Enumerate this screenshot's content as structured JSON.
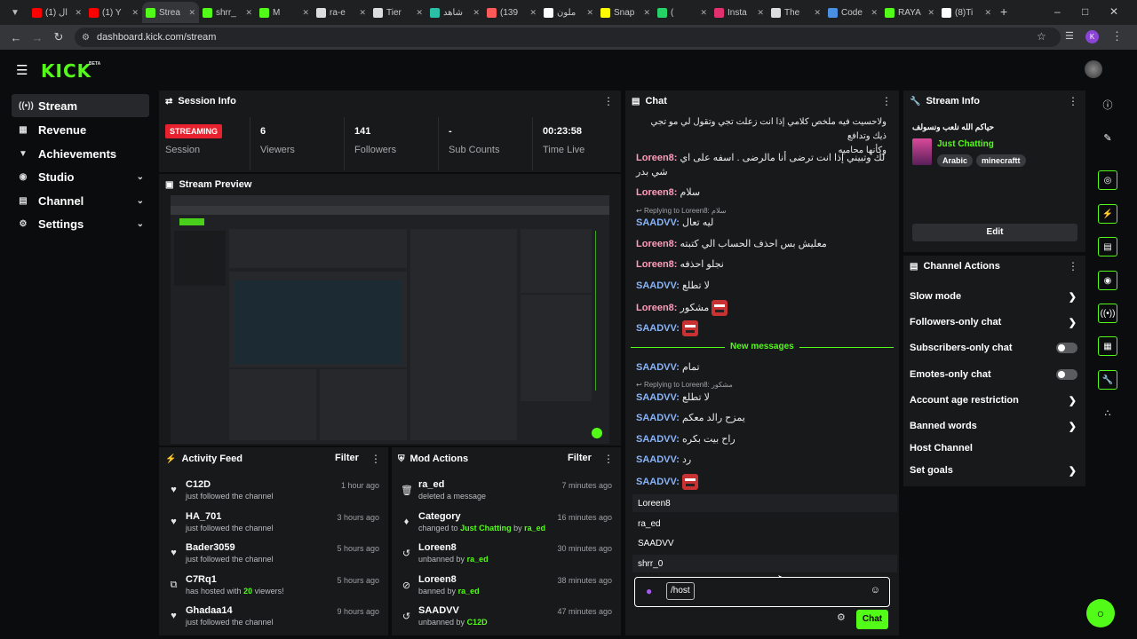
{
  "browser": {
    "tabs": [
      {
        "label": "(1) ال",
        "color": "#ff0000",
        "icon": "youtube-icon"
      },
      {
        "label": "(1) Y",
        "color": "#ff0000",
        "icon": "youtube-icon"
      },
      {
        "label": "Strea",
        "color": "#53fc18",
        "icon": "kick-icon",
        "active": true
      },
      {
        "label": "shrr_",
        "color": "#53fc18",
        "icon": "kick-icon"
      },
      {
        "label": "M",
        "color": "#53fc18",
        "icon": "kick-icon"
      },
      {
        "label": "ra-e",
        "color": "#dddddd",
        "icon": "site-icon"
      },
      {
        "label": "Tier",
        "color": "#dddddd",
        "icon": "site-icon"
      },
      {
        "label": "شاهد",
        "color": "#29c0a6",
        "icon": "site-icon"
      },
      {
        "label": "(139",
        "color": "#ff5a5a",
        "icon": "site-icon"
      },
      {
        "label": "ملون",
        "color": "#ffffff",
        "icon": "google-icon"
      },
      {
        "label": "Snap",
        "color": "#fffc00",
        "icon": "snapchat-icon"
      },
      {
        "label": "(",
        "color": "#25d366",
        "icon": "whatsapp-icon"
      },
      {
        "label": "Insta",
        "color": "#e1306c",
        "icon": "instagram-icon"
      },
      {
        "label": "The",
        "color": "#dddddd",
        "icon": "site-icon"
      },
      {
        "label": "Code",
        "color": "#4a90e2",
        "icon": "site-icon"
      },
      {
        "label": "RAYA",
        "color": "#53fc18",
        "icon": "kick-icon"
      },
      {
        "label": "(8)Ti",
        "color": "#ffffff",
        "icon": "tiktok-icon"
      }
    ],
    "url": "dashboard.kick.com/stream"
  },
  "brand": {
    "logo": "KICK",
    "beta": "BETA",
    "accent": "#53fc18"
  },
  "sidebar": {
    "items": [
      {
        "label": "Stream",
        "icon": "broadcast-icon",
        "active": true
      },
      {
        "label": "Revenue",
        "icon": "money-icon"
      },
      {
        "label": "Achievements",
        "icon": "trophy-icon"
      },
      {
        "label": "Studio",
        "icon": "studio-icon",
        "expandable": true
      },
      {
        "label": "Channel",
        "icon": "channel-icon",
        "expandable": true
      },
      {
        "label": "Settings",
        "icon": "gear-icon",
        "expandable": true
      }
    ]
  },
  "session": {
    "title": "Session Info",
    "status": "STREAMING",
    "status_label": "Session",
    "stats": [
      {
        "value": "6",
        "label": "Viewers"
      },
      {
        "value": "141",
        "label": "Followers"
      },
      {
        "value": "-",
        "label": "Sub Counts"
      },
      {
        "value": "00:23:58",
        "label": "Time Live"
      }
    ]
  },
  "preview": {
    "title": "Stream Preview"
  },
  "activity": {
    "title": "Activity Feed",
    "filter": "Filter",
    "items": [
      {
        "icon": "heart-icon",
        "name": "C12D",
        "desc": "just followed the channel",
        "time": "1 hour ago"
      },
      {
        "icon": "heart-icon",
        "name": "HA_701",
        "desc": "just followed the channel",
        "time": "3 hours ago"
      },
      {
        "icon": "heart-icon",
        "name": "Bader3059",
        "desc": "just followed the channel",
        "time": "5 hours ago"
      },
      {
        "icon": "host-icon",
        "name": "C7Rq1",
        "desc_pre": "has hosted with",
        "count": "20",
        "desc_post": "viewers!",
        "time": "5 hours ago"
      },
      {
        "icon": "heart-icon",
        "name": "Ghadaa14",
        "desc": "just followed the channel",
        "time": "9 hours ago"
      }
    ]
  },
  "modactions": {
    "title": "Mod Actions",
    "filter": "Filter",
    "items": [
      {
        "icon": "trash-icon",
        "name": "ra_ed",
        "desc": "deleted a message",
        "time": "7 minutes ago"
      },
      {
        "icon": "category-icon",
        "name": "Category",
        "desc_pre": "changed to",
        "target": "Just Chatting",
        "by": "by",
        "actor": "ra_ed",
        "time": "16 minutes ago"
      },
      {
        "icon": "unban-icon",
        "name": "Loreen8",
        "desc_pre": "unbanned by",
        "actor": "ra_ed",
        "time": "30 minutes ago"
      },
      {
        "icon": "ban-icon",
        "name": "Loreen8",
        "desc_pre": "banned by",
        "actor": "ra_ed",
        "time": "38 minutes ago"
      },
      {
        "icon": "unban-icon",
        "name": "SAADVV",
        "desc_pre": "unbanned by",
        "actor": "C12D",
        "time": "47 minutes ago"
      }
    ]
  },
  "chat": {
    "title": "Chat",
    "top_text_1": "ولاحسيت فيه ملخص كلامي إذا انت زعلت تجي وتقول لي مو تجي ذيك وتدافع",
    "top_text_2": "وكأنها محاميه",
    "messages": [
      {
        "user": "Loreen8",
        "color": "#ff9cba",
        "text": "لك وتبيني إذا انت ترضى أنا مالرضى . اسفه على اي شي بدر"
      },
      {
        "user": "Loreen8",
        "color": "#ff9cba",
        "text": "سلام"
      },
      {
        "user": "SAADVV",
        "color": "#8ab4f8",
        "text": "ليه تعال"
      },
      {
        "user": "Loreen8",
        "color": "#ff9cba",
        "text": "معليش بس احذف الحساب الي كتبته"
      },
      {
        "user": "Loreen8",
        "color": "#ff9cba",
        "text": "نجلو احذفه"
      },
      {
        "user": "SAADVV",
        "color": "#8ab4f8",
        "text": "لا تطلع"
      },
      {
        "user": "Loreen8",
        "color": "#ff9cba",
        "text": "مشكور"
      },
      {
        "user": "SAADVV",
        "color": "#8ab4f8",
        "text": ""
      },
      {
        "user": "SAADVV",
        "color": "#8ab4f8",
        "text": "تمام"
      },
      {
        "user": "SAADVV",
        "color": "#8ab4f8",
        "text": "لا تطلع"
      },
      {
        "user": "SAADVV",
        "color": "#8ab4f8",
        "text": "يمزح رالد معكم"
      },
      {
        "user": "SAADVV",
        "color": "#8ab4f8",
        "text": "راح بيت بكره"
      },
      {
        "user": "SAADVV",
        "color": "#8ab4f8",
        "text": "رد"
      },
      {
        "user": "SAADVV",
        "color": "#8ab4f8",
        "text": ""
      }
    ],
    "reply_1": "Replying to Loreen8: سلام",
    "reply_2": "Replying to Loreen8: مشكور",
    "new_messages": "New messages",
    "suggestions": [
      "Loreen8",
      "ra_ed",
      "SAADVV",
      "shrr_0"
    ],
    "input_value": "/host",
    "send_label": "Chat"
  },
  "streaminfo": {
    "title": "Stream Info",
    "stream_title": "حياكم الله نلعب ونسولف",
    "category": "Just Chatting",
    "tags": [
      "Arabic",
      "minecraftt"
    ],
    "edit_label": "Edit"
  },
  "channelactions": {
    "title": "Channel Actions",
    "items": [
      {
        "label": "Slow mode",
        "control": "chevron"
      },
      {
        "label": "Followers-only chat",
        "control": "chevron"
      },
      {
        "label": "Subscribers-only chat",
        "control": "toggle",
        "state": "off"
      },
      {
        "label": "Emotes-only chat",
        "control": "toggle",
        "state": "off"
      },
      {
        "label": "Account age restriction",
        "control": "chevron"
      },
      {
        "label": "Banned words",
        "control": "chevron"
      },
      {
        "label": "Host Channel",
        "control": "none"
      },
      {
        "label": "Set goals",
        "control": "chevron"
      }
    ]
  }
}
